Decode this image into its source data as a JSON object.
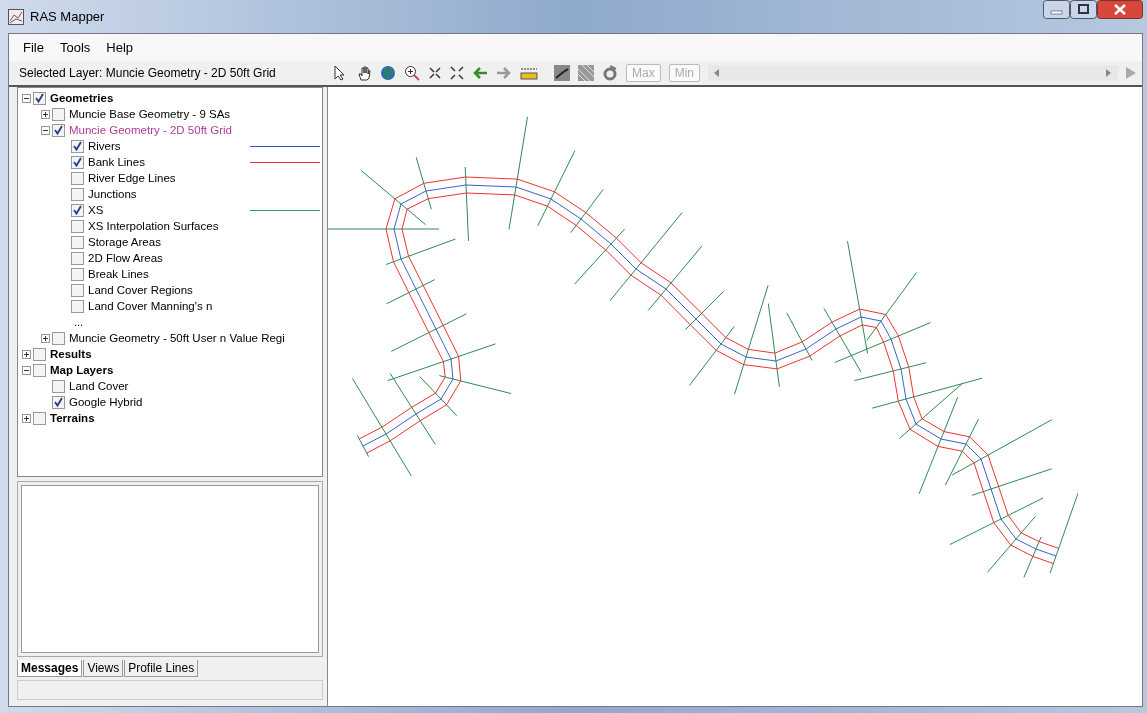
{
  "window": {
    "title": "RAS Mapper"
  },
  "menu": [
    "File",
    "Tools",
    "Help"
  ],
  "selected_layer": "Selected Layer: Muncie Geometry - 2D 50ft Grid",
  "toolbar": {
    "buttons": [
      {
        "label": "Max",
        "disabled": true
      },
      {
        "label": "Min",
        "disabled": true
      }
    ]
  },
  "tree": [
    {
      "label": "Geometries",
      "checked": true,
      "expanded": true,
      "selected": false,
      "children": [
        {
          "label": "Muncie Base Geometry - 9 SAs",
          "checked": false,
          "expanded": false,
          "selected": false
        },
        {
          "label": "Muncie Geometry - 2D 50ft Grid",
          "checked": true,
          "expanded": true,
          "selected": true,
          "overflow": "...",
          "children": [
            {
              "label": "Rivers",
              "checked": true,
              "selected": false,
              "color": "#3355cc"
            },
            {
              "label": "Bank Lines",
              "checked": true,
              "selected": false,
              "color": "#ee3333"
            },
            {
              "label": "River Edge Lines",
              "checked": false,
              "selected": false
            },
            {
              "label": "Junctions",
              "checked": false,
              "selected": false
            },
            {
              "label": "XS",
              "checked": true,
              "selected": false,
              "color": "#339966"
            },
            {
              "label": "XS Interpolation Surfaces",
              "checked": false,
              "selected": false
            },
            {
              "label": "Storage Areas",
              "checked": false,
              "selected": false
            },
            {
              "label": "2D Flow Areas",
              "checked": false,
              "selected": false
            },
            {
              "label": "Break Lines",
              "checked": false,
              "selected": false
            },
            {
              "label": "Land Cover Regions",
              "checked": false,
              "selected": false
            },
            {
              "label": "Land Cover Manning's n",
              "checked": false,
              "selected": false
            }
          ]
        },
        {
          "label": "Muncie Geometry - 50ft User n Value Regi",
          "checked": false,
          "expanded": false,
          "selected": false
        }
      ]
    },
    {
      "label": "Results",
      "checked": false,
      "expanded": false,
      "selected": false
    },
    {
      "label": "Map Layers",
      "checked": false,
      "expanded": true,
      "selected": false,
      "children": [
        {
          "label": "Land Cover",
          "checked": false,
          "selected": false
        },
        {
          "label": "Google Hybrid",
          "checked": true,
          "selected": false
        }
      ]
    },
    {
      "label": "Terrains",
      "checked": false,
      "expanded": false,
      "selected": false
    }
  ],
  "tabs": [
    {
      "label": "Messages",
      "selected": true
    },
    {
      "label": "Views",
      "selected": false
    },
    {
      "label": "Profile Lines",
      "selected": false
    }
  ]
}
